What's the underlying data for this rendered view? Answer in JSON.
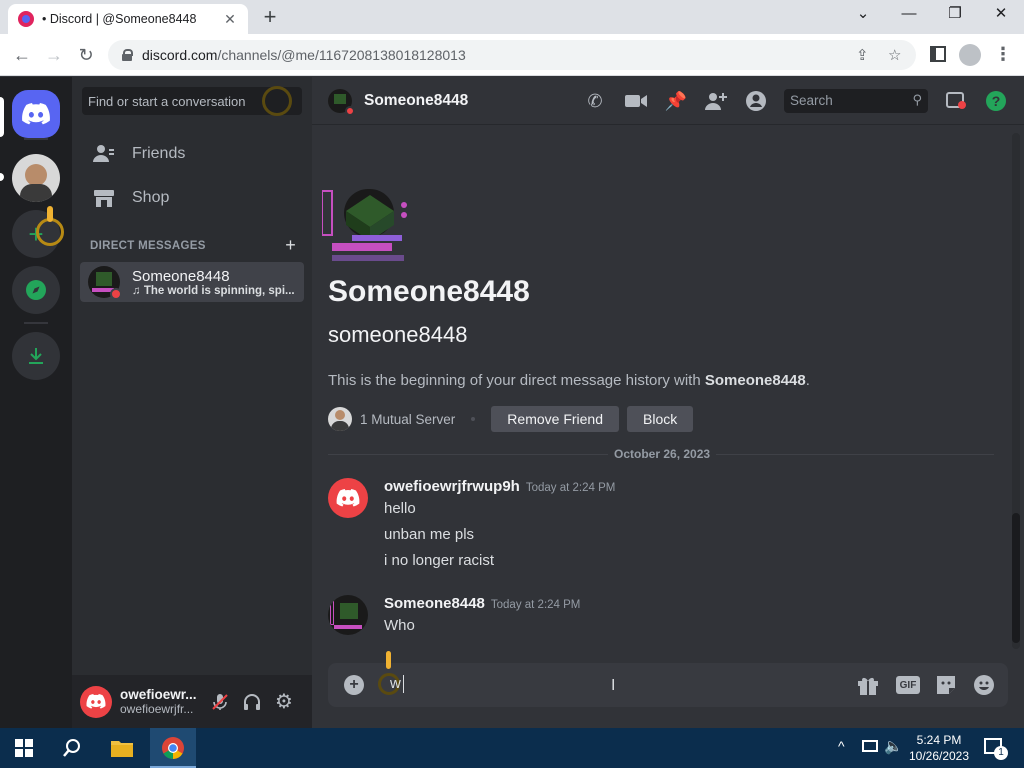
{
  "browser": {
    "tab_title": "• Discord | @Someone8448",
    "tab_close": "✕",
    "new_tab": "+",
    "url_domain": "discord.com",
    "url_path": "/channels/@me/1167208138018128013",
    "min": "—",
    "max": "❐",
    "close": "✕"
  },
  "sidebar": {
    "search_placeholder": "Find or start a conversation",
    "friends": "Friends",
    "shop": "Shop",
    "dm_header": "DIRECT MESSAGES",
    "dm_add": "+",
    "dm": {
      "name": "Someone8448",
      "status": "The world is spinning, spi..."
    }
  },
  "user_panel": {
    "name": "owefioewr...",
    "tag": "owefioewrjfr..."
  },
  "header": {
    "name": "Someone8448",
    "search": "Search"
  },
  "profile": {
    "display_name": "Someone8448",
    "username": "someone8448",
    "intro_prefix": "This is the beginning of your direct message history with ",
    "intro_name": "Someone8448",
    "intro_suffix": ".",
    "mutual": "1 Mutual Server",
    "remove_friend": "Remove Friend",
    "block": "Block"
  },
  "date_divider": "October 26, 2023",
  "messages": [
    {
      "author": "owefioewrjfrwup9h",
      "time": "Today at 2:24 PM",
      "lines": [
        "hello",
        "unban me pls",
        "i no longer racist"
      ]
    },
    {
      "author": "Someone8448",
      "time": "Today at 2:24 PM",
      "lines": [
        "Who"
      ]
    }
  ],
  "composer": {
    "typed": "w"
  },
  "taskbar": {
    "time": "5:24 PM",
    "date": "10/26/2023",
    "notif_count": "1"
  },
  "colors": {
    "blurple": "#5865f2",
    "red": "#ed4245",
    "green": "#23a55a",
    "bg": "#313338"
  }
}
